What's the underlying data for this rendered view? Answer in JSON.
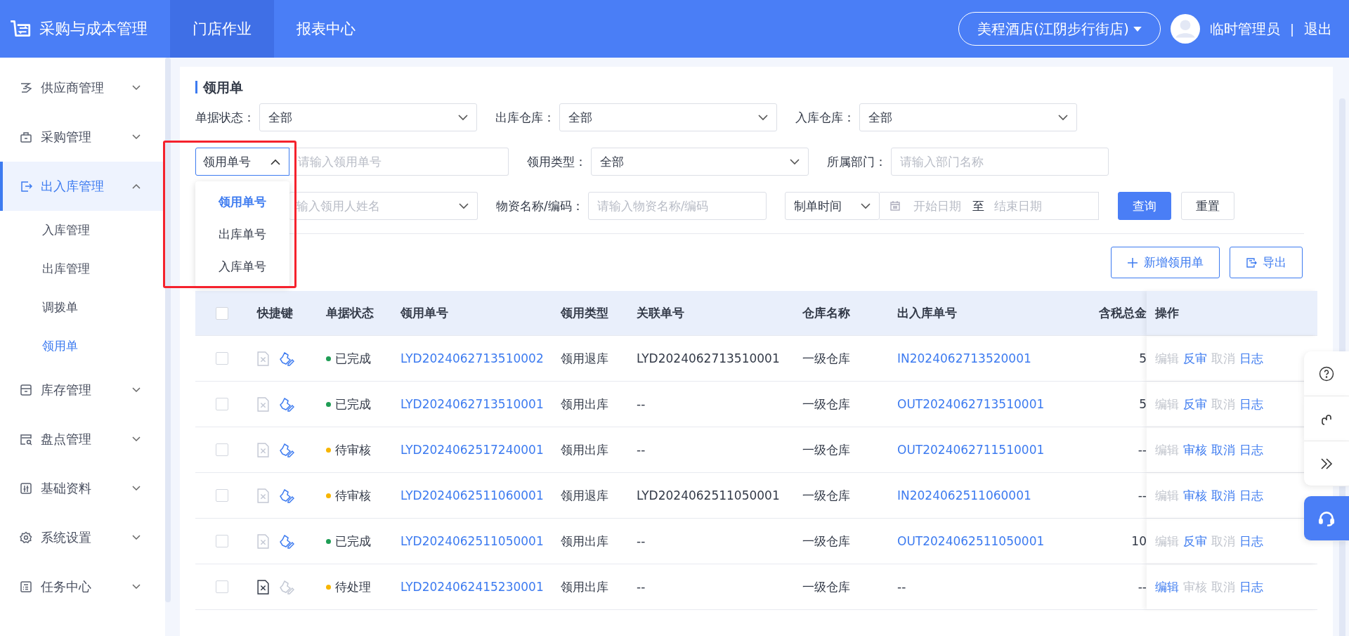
{
  "header": {
    "app_title": "采购与成本管理",
    "nav": [
      {
        "label": "门店作业",
        "selected": true
      },
      {
        "label": "报表中心",
        "selected": false
      }
    ],
    "store": "美程酒店(江阴步行街店)",
    "user": "临时管理员",
    "separator": "|",
    "logout": "退出"
  },
  "sidebar": {
    "items": [
      {
        "label": "供应商管理",
        "expanded": false,
        "selected": false
      },
      {
        "label": "采购管理",
        "expanded": false,
        "selected": false
      },
      {
        "label": "出入库管理",
        "expanded": true,
        "selected": true,
        "children": [
          {
            "label": "入库管理",
            "selected": false
          },
          {
            "label": "出库管理",
            "selected": false
          },
          {
            "label": "调拨单",
            "selected": false
          },
          {
            "label": "领用单",
            "selected": true
          }
        ]
      },
      {
        "label": "库存管理",
        "expanded": false,
        "selected": false
      },
      {
        "label": "盘点管理",
        "expanded": false,
        "selected": false
      },
      {
        "label": "基础资料",
        "expanded": false,
        "selected": false
      },
      {
        "label": "系统设置",
        "expanded": false,
        "selected": false
      },
      {
        "label": "任务中心",
        "expanded": false,
        "selected": false
      }
    ]
  },
  "page": {
    "title": "领用单",
    "filters": [
      [
        {
          "kind": "select",
          "label": "单据状态：",
          "value": "全部"
        },
        {
          "kind": "select",
          "label": "出库仓库：",
          "value": "全部"
        },
        {
          "kind": "select",
          "label": "入库仓库：",
          "value": "全部"
        }
      ],
      [
        {
          "kind": "type-input",
          "value": "领用单号",
          "expanded": true,
          "placeholder": "请输入领用单号",
          "options": [
            {
              "label": "领用单号",
              "selected": true
            },
            {
              "label": "出库单号",
              "selected": false
            },
            {
              "label": "入库单号",
              "selected": false
            }
          ]
        },
        {
          "kind": "select",
          "label": "领用类型：",
          "value": "全部"
        },
        {
          "kind": "input",
          "label": "所属部门：",
          "placeholder": "请输入部门名称"
        }
      ],
      [
        {
          "kind": "select",
          "placeholder": "输入领用人姓名"
        },
        {
          "kind": "input",
          "label": "物资名称/编码：",
          "placeholder": "请输入物资名称/编码"
        },
        {
          "kind": "date-range",
          "value": "制单时间",
          "start_placeholder": "开始日期",
          "separator": "至",
          "end_placeholder": "结束日期"
        }
      ]
    ],
    "query_button": "查询",
    "reset_button": "重置",
    "add_button": "新增领用单",
    "export_button": "导出",
    "table": {
      "all_checked": false,
      "columns": [
        "快捷键",
        "单据状态",
        "领用单号",
        "领用类型",
        "关联单号",
        "仓库名称",
        "出入库单号",
        "含税总金",
        "操作"
      ],
      "rows": [
        {
          "checked": false,
          "delete_disabled": true,
          "edit_disabled": false,
          "status": "已完成",
          "color": "#1f9d55",
          "number": "LYD2024062713510002",
          "type": "领用退库",
          "related": "LYD2024062713510001",
          "warehouse": "一级仓库",
          "io_number": "IN2024062713520001",
          "io_link": true,
          "amount": "5",
          "actions": [
            {
              "label": "编辑",
              "disabled": true
            },
            {
              "label": "反审",
              "disabled": false
            },
            {
              "label": "取消",
              "disabled": true
            },
            {
              "label": "日志",
              "disabled": false
            }
          ]
        },
        {
          "checked": false,
          "delete_disabled": true,
          "edit_disabled": false,
          "status": "已完成",
          "color": "#1f9d55",
          "number": "LYD2024062713510001",
          "type": "领用出库",
          "related": "--",
          "warehouse": "一级仓库",
          "io_number": "OUT2024062713510001",
          "io_link": true,
          "amount": "5",
          "actions": [
            {
              "label": "编辑",
              "disabled": true
            },
            {
              "label": "反审",
              "disabled": false
            },
            {
              "label": "取消",
              "disabled": true
            },
            {
              "label": "日志",
              "disabled": false
            }
          ]
        },
        {
          "checked": false,
          "delete_disabled": true,
          "edit_disabled": false,
          "status": "待审核",
          "color": "#f7b500",
          "number": "LYD2024062517240001",
          "type": "领用出库",
          "related": "--",
          "warehouse": "一级仓库",
          "io_number": "OUT2024062711510001",
          "io_link": true,
          "amount": "--",
          "actions": [
            {
              "label": "编辑",
              "disabled": true
            },
            {
              "label": "审核",
              "disabled": false
            },
            {
              "label": "取消",
              "disabled": false
            },
            {
              "label": "日志",
              "disabled": false
            }
          ]
        },
        {
          "checked": false,
          "delete_disabled": true,
          "edit_disabled": false,
          "status": "待审核",
          "color": "#f7b500",
          "number": "LYD2024062511060001",
          "type": "领用退库",
          "related": "LYD2024062511050001",
          "warehouse": "一级仓库",
          "io_number": "IN2024062511060001",
          "io_link": true,
          "amount": "--",
          "actions": [
            {
              "label": "编辑",
              "disabled": true
            },
            {
              "label": "审核",
              "disabled": false
            },
            {
              "label": "取消",
              "disabled": false
            },
            {
              "label": "日志",
              "disabled": false
            }
          ]
        },
        {
          "checked": false,
          "delete_disabled": true,
          "edit_disabled": false,
          "status": "已完成",
          "color": "#1f9d55",
          "number": "LYD2024062511050001",
          "type": "领用出库",
          "related": "--",
          "warehouse": "一级仓库",
          "io_number": "OUT2024062511050001",
          "io_link": true,
          "amount": "10",
          "actions": [
            {
              "label": "编辑",
              "disabled": true
            },
            {
              "label": "反审",
              "disabled": false
            },
            {
              "label": "取消",
              "disabled": true
            },
            {
              "label": "日志",
              "disabled": false
            }
          ]
        },
        {
          "checked": false,
          "delete_disabled": false,
          "edit_disabled": true,
          "status": "待处理",
          "color": "#f7b500",
          "number": "LYD2024062415230001",
          "type": "领用出库",
          "related": "--",
          "warehouse": "一级仓库",
          "io_number": "--",
          "io_link": false,
          "amount": "--",
          "actions": [
            {
              "label": "编辑",
              "disabled": false
            },
            {
              "label": "审核",
              "disabled": true
            },
            {
              "label": "取消",
              "disabled": true
            },
            {
              "label": "日志",
              "disabled": false
            }
          ]
        }
      ]
    }
  }
}
